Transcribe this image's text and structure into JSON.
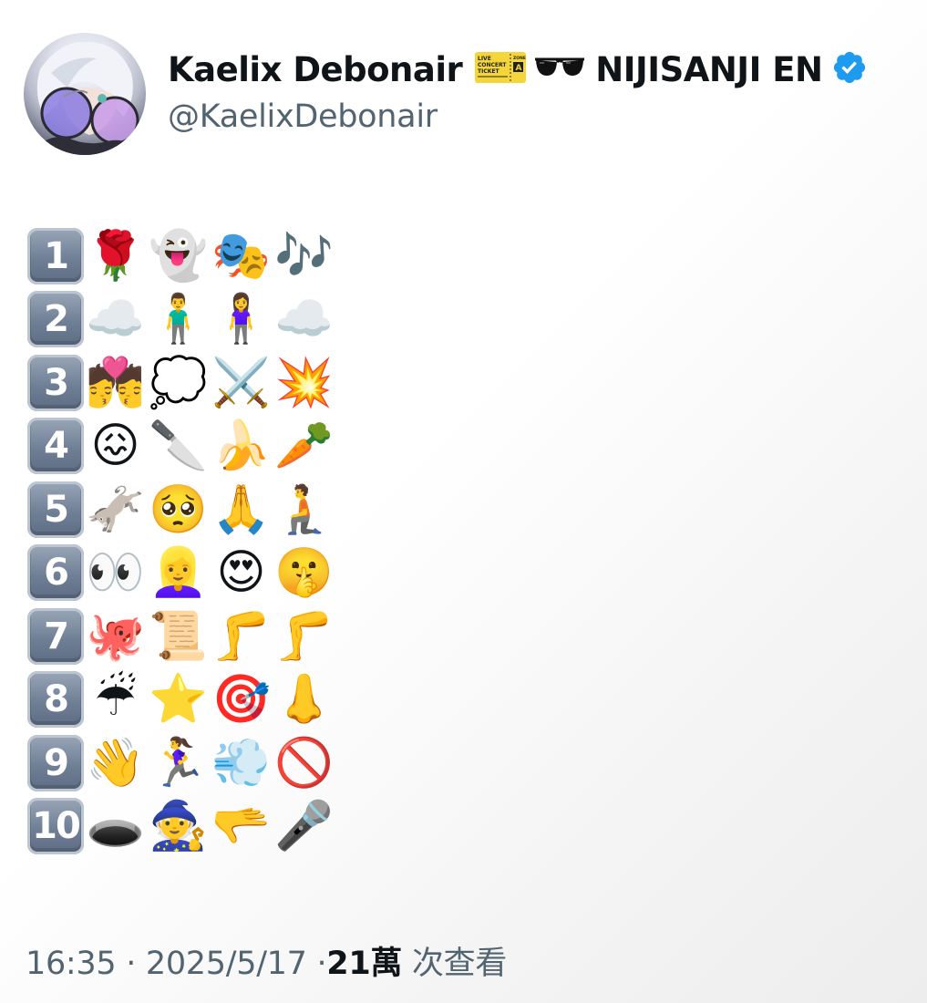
{
  "profile": {
    "display_name": "Kaelix Debonair",
    "name_suffix": "NIJISANJI EN",
    "handle": "@KaelixDebonair",
    "verified": true,
    "icons": [
      "ticket-icon",
      "sunglasses-icon",
      "verified-badge-icon"
    ],
    "ticket_text": {
      "line1": "LIVE",
      "line2": "CONCERT",
      "line3": "TICKET",
      "zone_label": "ZONE",
      "zone_value": "A"
    }
  },
  "tweet": {
    "rows": [
      {
        "number": "1",
        "emojis": [
          "🌹",
          "👻",
          "🎭",
          "🎶"
        ]
      },
      {
        "number": "2",
        "emojis": [
          "☁️",
          "🧍‍♂️",
          "🧍‍♀️",
          "☁️"
        ]
      },
      {
        "number": "3",
        "emojis": [
          "💏",
          "💭",
          "⚔️",
          "💥"
        ]
      },
      {
        "number": "4",
        "emojis": [
          "😖",
          "🔪",
          "🍌",
          "🥕"
        ]
      },
      {
        "number": "5",
        "emojis": [
          "🫏",
          "🥺",
          "🙏",
          "🧎"
        ]
      },
      {
        "number": "6",
        "emojis": [
          "👀",
          "👱‍♀️",
          "😍",
          "🤫"
        ]
      },
      {
        "number": "7",
        "emojis": [
          "🐙",
          "📜",
          "🦵",
          "🦵"
        ]
      },
      {
        "number": "8",
        "emojis": [
          "☔",
          "⭐",
          "🎯",
          "👃"
        ]
      },
      {
        "number": "9",
        "emojis": [
          "👋",
          "🏃‍♀️",
          "💨",
          "🚫"
        ]
      },
      {
        "number": "10",
        "emojis": [
          "🕳️",
          "🧙",
          "🫳",
          "🎤"
        ]
      }
    ]
  },
  "footer": {
    "time": "16:35",
    "date": "2025/5/17",
    "separator": "·",
    "views_count": "21萬",
    "views_label": "次查看"
  },
  "colors": {
    "text_primary": "#0f1419",
    "text_secondary": "#536471",
    "verified_blue": "#1d9bf0",
    "keycap": "#7b8aa0"
  }
}
